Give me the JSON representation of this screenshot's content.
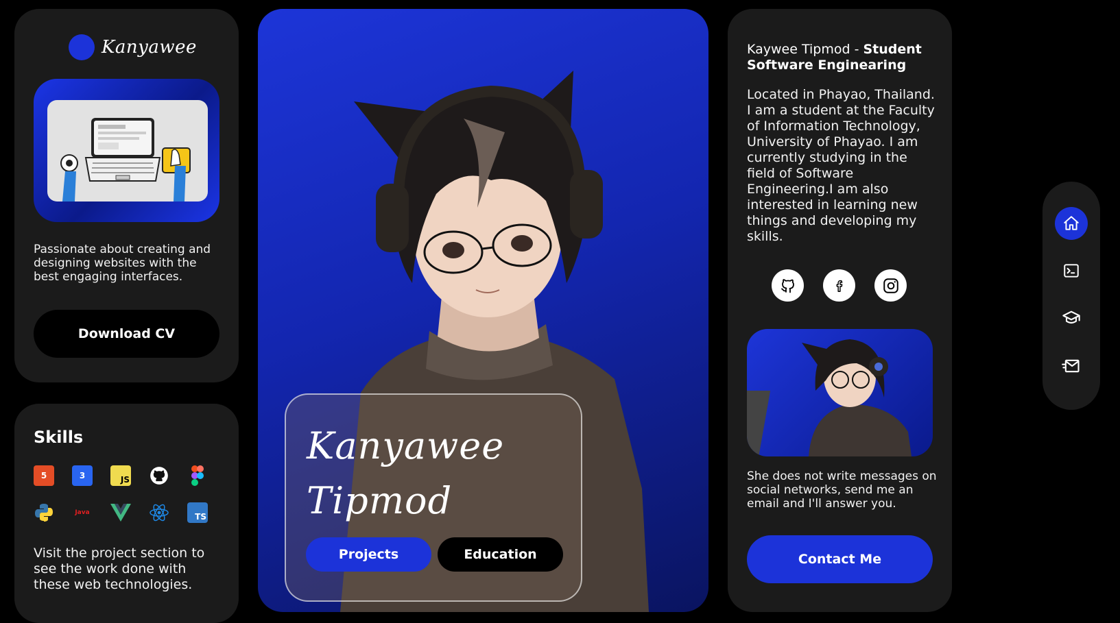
{
  "brand": {
    "name": "Kanyawee"
  },
  "left": {
    "description": "Passionate about creating and designing websites with the best engaging interfaces.",
    "download_cv": "Download CV"
  },
  "skills": {
    "title": "Skills",
    "items": [
      {
        "icon": "html5-icon",
        "label": "5",
        "color": "#e44d26"
      },
      {
        "icon": "css3-icon",
        "label": "3",
        "color": "#2965f1"
      },
      {
        "icon": "javascript-icon",
        "label": "JS",
        "color": "#f0db4f"
      },
      {
        "icon": "github-icon",
        "label": "",
        "color": "#ffffff"
      },
      {
        "icon": "figma-icon",
        "label": "",
        "color": "#f24e1e"
      },
      {
        "icon": "python-icon",
        "label": "",
        "color": "#3776ab"
      },
      {
        "icon": "java-icon",
        "label": "Java",
        "color": "#e11f21"
      },
      {
        "icon": "vue-icon",
        "label": "V",
        "color": "#42b883"
      },
      {
        "icon": "react-icon",
        "label": "⚛",
        "color": "#1e88e5"
      },
      {
        "icon": "typescript-icon",
        "label": "TS",
        "color": "#3178c6"
      }
    ],
    "description": "Visit the project section to see the work done with these web technologies."
  },
  "hero": {
    "name_line1": "Kanyawee",
    "name_line2": "Tipmod",
    "projects_label": "Projects",
    "education_label": "Education"
  },
  "about": {
    "title_plain": "Kaywee Tipmod - ",
    "title_bold": "Student Software Enginearing",
    "body": "Located in Phayao, Thailand. I am a student at the Faculty of Information Technology, University of Phayao. I am currently studying in the field of Software Engineering.I am also interested in learning new things and developing my skills.",
    "socials": [
      "github-icon",
      "facebook-icon",
      "instagram-icon"
    ],
    "note": "She does not write messages on social networks, send me an email and I'll answer you.",
    "contact_label": "Contact Me"
  },
  "nav": {
    "items": [
      {
        "icon": "home-icon",
        "active": true
      },
      {
        "icon": "terminal-icon",
        "active": false
      },
      {
        "icon": "graduation-cap-icon",
        "active": false
      },
      {
        "icon": "mail-send-icon",
        "active": false
      }
    ]
  },
  "colors": {
    "accent": "#1c33d9",
    "card": "#1b1b1b",
    "background": "#000000"
  }
}
